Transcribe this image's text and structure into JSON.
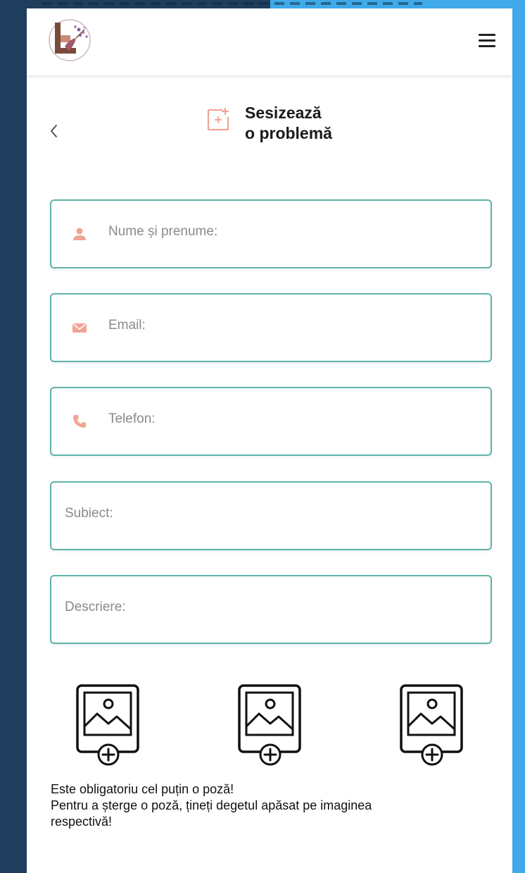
{
  "page": {
    "title_line1": "Sesizează",
    "title_line2": "o problemă"
  },
  "header": {
    "logo_icon": "app-logo-icon",
    "menu_icon": "hamburger-menu-icon"
  },
  "navigation": {
    "back_icon": "chevron-left-icon"
  },
  "form": {
    "name_placeholder": "Nume și prenume:",
    "email_placeholder": "Email:",
    "phone_placeholder": "Telefon:",
    "subject_placeholder": "Subiect:",
    "description_placeholder": "Descriere:"
  },
  "photos": {
    "slot_icon": "add-photo-icon",
    "count": 3
  },
  "notes": {
    "line1": "Este obligatoriu cel puțin o poză!",
    "line2": "Pentru a șterge o poză, țineți degetul apăsat pe imaginea",
    "line3": "respectivă!"
  },
  "colors": {
    "accent_border": "#5fb3a8",
    "icon_salmon": "#f0a593",
    "background_dark": "#1f3d5c",
    "background_blue": "#3fa9ea"
  }
}
